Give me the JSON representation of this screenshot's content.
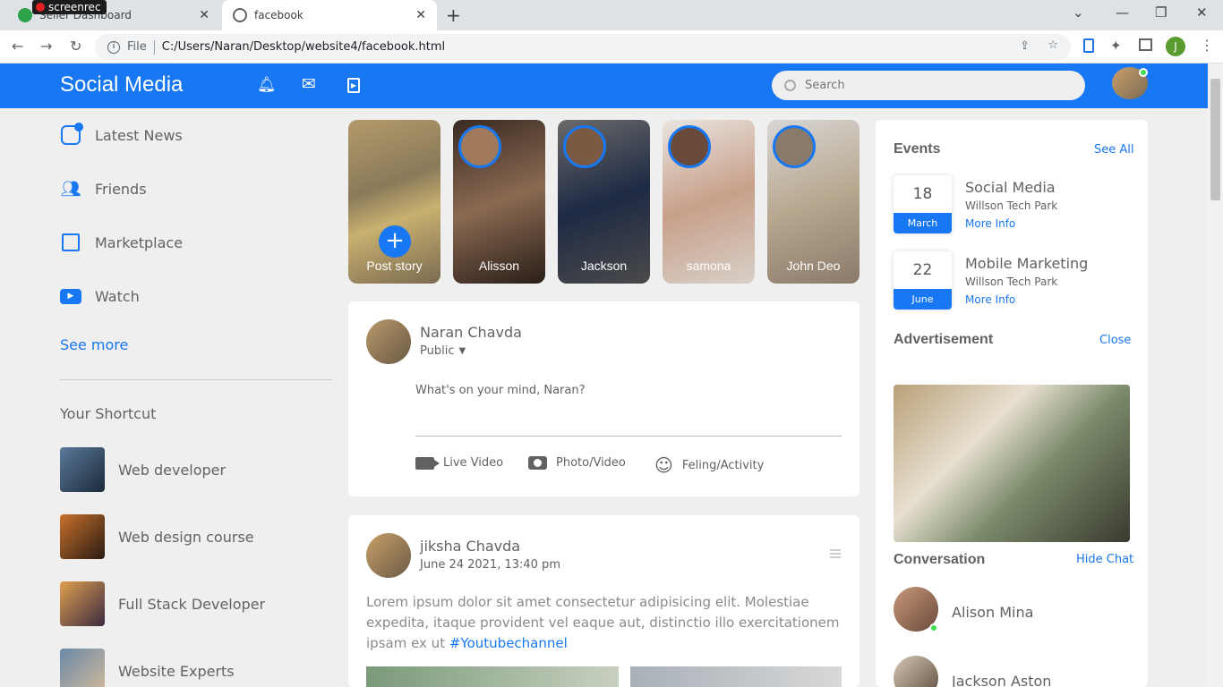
{
  "browser": {
    "tabs": [
      {
        "label": "Seller Dashboard"
      },
      {
        "label": "facebook"
      }
    ],
    "recorder_label": "screenrec",
    "address": {
      "file_label": "File",
      "url": "C:/Users/Naran/Desktop/website4/facebook.html"
    },
    "profile_initial": "J"
  },
  "nav": {
    "brand": "Social Media",
    "search_placeholder": "Search"
  },
  "sidebar": {
    "items": [
      {
        "label": "Latest News",
        "icon": "news-icon"
      },
      {
        "label": "Friends",
        "icon": "friends-icon"
      },
      {
        "label": "Marketplace",
        "icon": "bag-icon"
      },
      {
        "label": "Watch",
        "icon": "play-icon"
      }
    ],
    "see_more": "See more",
    "shortcut_title": "Your Shortcut",
    "shortcuts": [
      {
        "label": "Web developer"
      },
      {
        "label": "Web design course"
      },
      {
        "label": "Full Stack Developer"
      },
      {
        "label": "Website Experts"
      }
    ]
  },
  "stories": [
    {
      "name": "Post story"
    },
    {
      "name": "Alisson"
    },
    {
      "name": "Jackson"
    },
    {
      "name": "samona"
    },
    {
      "name": "John Deo"
    }
  ],
  "composer": {
    "user": "Naran Chavda",
    "privacy": "Public",
    "placeholder": "What's on your mind, Naran?",
    "actions": [
      {
        "label": "Live Video"
      },
      {
        "label": "Photo/Video"
      },
      {
        "label": "Feling/Activity"
      }
    ]
  },
  "post": {
    "user": "jiksha Chavda",
    "date": "June 24 2021, 13:40 pm",
    "text": "Lorem ipsum dolor sit amet consectetur adipisicing elit. Molestiae expedita, itaque provident vel eaque aut, distinctio illo exercitationem ipsam ex ut",
    "hashtag": "#Youtubechannel"
  },
  "events": {
    "title": "Events",
    "see_all": "See All",
    "items": [
      {
        "day": "18",
        "month": "March",
        "title": "Social Media",
        "place": "Willson Tech Park",
        "link": "More Info"
      },
      {
        "day": "22",
        "month": "June",
        "title": "Mobile Marketing",
        "place": "Willson Tech Park",
        "link": "More Info"
      }
    ]
  },
  "advertisement": {
    "title": "Advertisement",
    "close": "Close"
  },
  "conversation": {
    "title": "Conversation",
    "hide": "Hide Chat",
    "contacts": [
      {
        "name": "Alison Mina"
      },
      {
        "name": "Jackson Aston"
      }
    ]
  }
}
